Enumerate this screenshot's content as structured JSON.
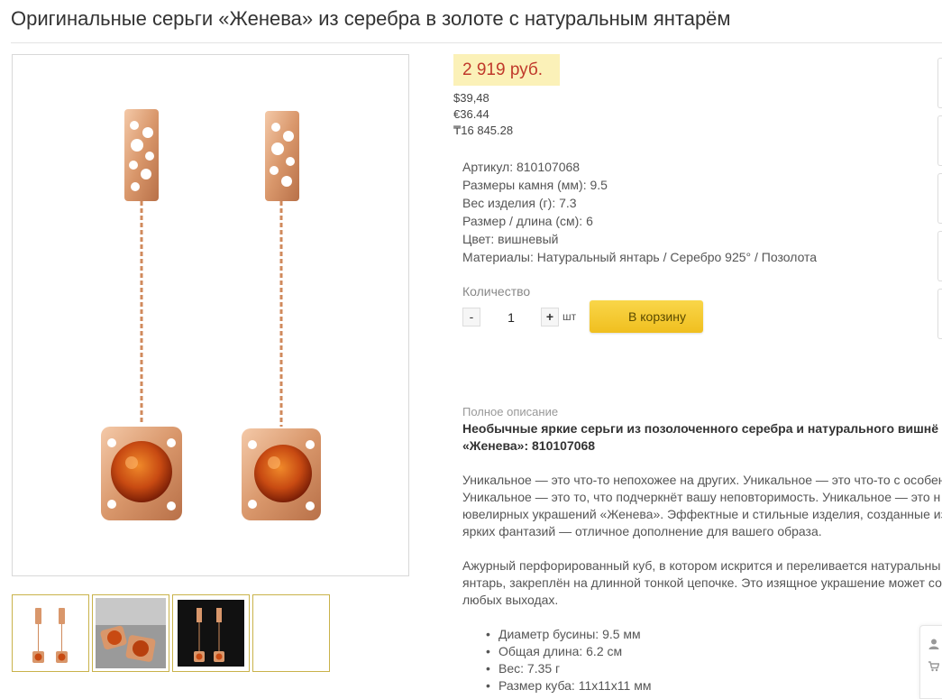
{
  "page": {
    "title": "Оригинальные серьги «Женева» из серебра в золоте с натуральным янтарём"
  },
  "product": {
    "price": "2 919 руб.",
    "alt_prices": [
      "$39,48",
      "€36.44",
      "₸16 845.28"
    ],
    "specs": [
      {
        "label": "Артикул:",
        "value": "810107068"
      },
      {
        "label": "Размеры камня (мм):",
        "value": "9.5"
      },
      {
        "label": "Вес изделия (г):",
        "value": "7.3"
      },
      {
        "label": "Размер / длина (см):",
        "value": "6"
      },
      {
        "label": "Цвет:",
        "value": "вишневый"
      },
      {
        "label": "Материалы:",
        "value": "Натуральный янтарь / Серебро 925° / Позолота"
      }
    ],
    "quantity": {
      "label": "Количество",
      "minus": "-",
      "value": "1",
      "plus": "+",
      "unit": "шт"
    },
    "cart_button": "В корзину"
  },
  "description": {
    "label": "Полное описание",
    "headline_lines": [
      "Необычные яркие серьги из позолоченного серебра и натурального вишнё",
      "«Женева»: 810107068"
    ],
    "paragraph1_lines": [
      "Уникальное — это что-то непохожее на других. Уникальное — это что-то с особен",
      "Уникальное — это то, что подчеркнёт вашу неповторимость. Уникальное — это н",
      "ювелирных украшений «Женева». Эффектные и стильные изделия, созданные из",
      "ярких фантазий — отличное дополнение для вашего образа."
    ],
    "paragraph2_lines": [
      "Ажурный перфорированный куб, в котором искрится и переливается натуральны",
      "янтарь, закреплён на длинной тонкой цепочке. Это изящное украшение может со",
      "любых выходах."
    ],
    "bullets": [
      "Диаметр бусины: 9.5 мм",
      "Общая длина: 6.2 см",
      "Вес: 7.35 г",
      "Размер куба: 11х11х11 мм"
    ]
  },
  "icons": {
    "side_tools": [
      "user-icon",
      "cart-icon"
    ]
  },
  "colors": {
    "price": "#c0392b",
    "price_bg": "#fbf1b8",
    "cart_button": "#f4c935",
    "gold": "#d9976b",
    "amber": "#c84a12"
  }
}
